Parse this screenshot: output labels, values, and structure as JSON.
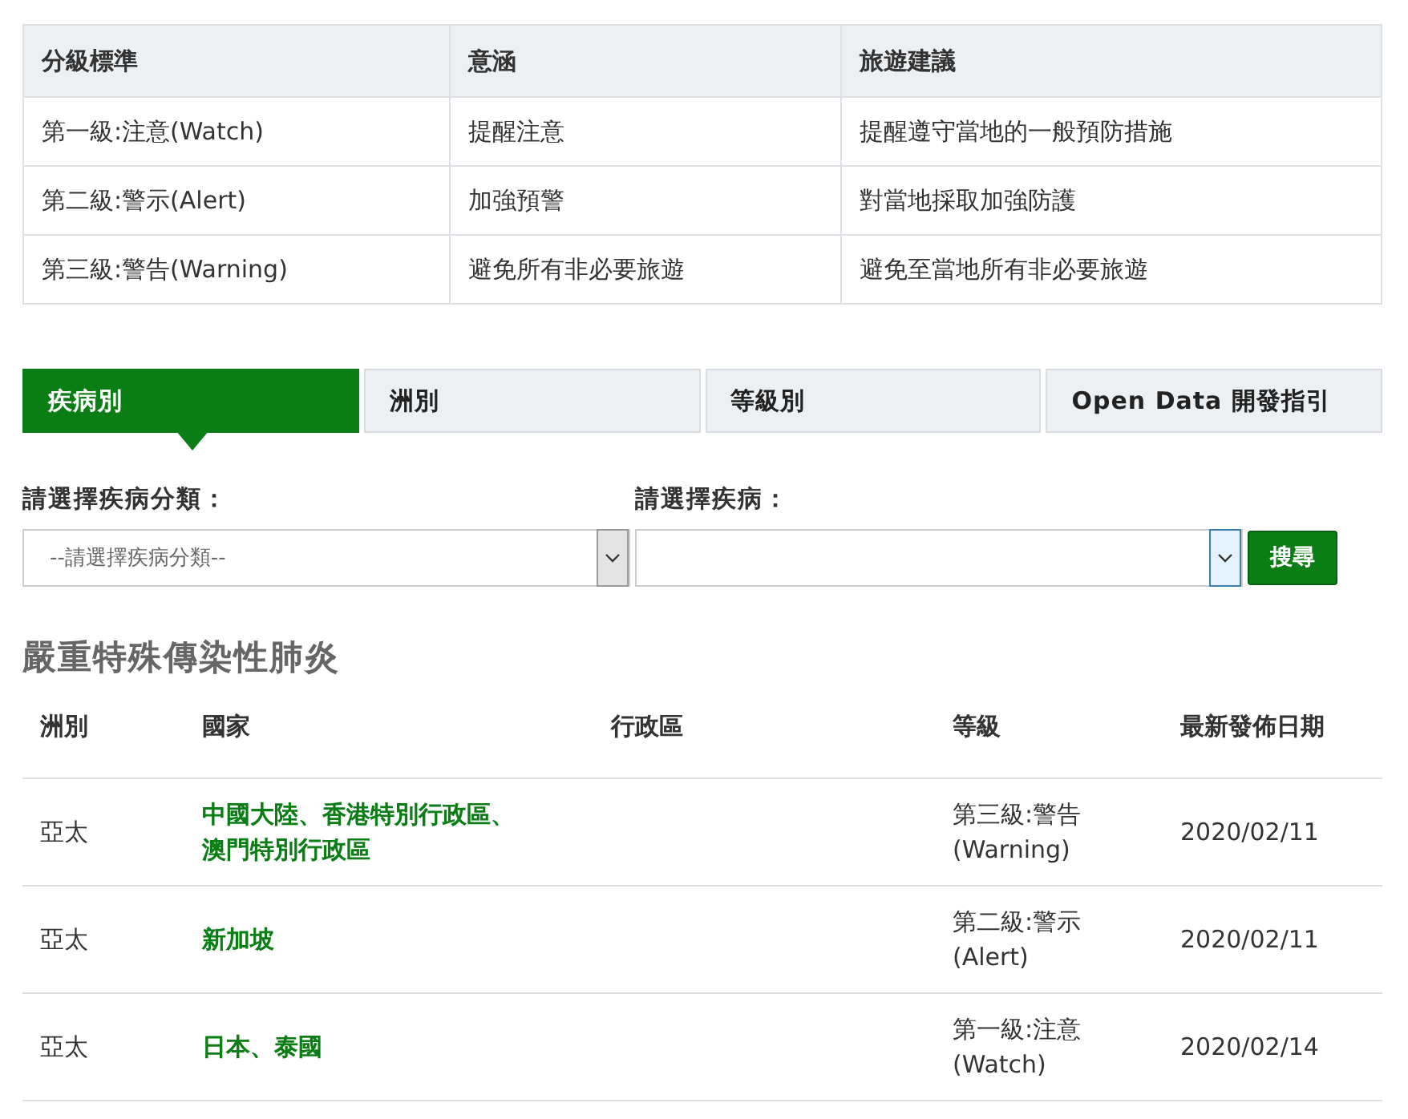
{
  "level_table": {
    "columns": [
      "分級標準",
      "意涵",
      "旅遊建議"
    ],
    "rows": [
      [
        "第一級:注意(Watch)",
        "提醒注意",
        "提醒遵守當地的一般預防措施"
      ],
      [
        "第二級:警示(Alert)",
        "加強預警",
        "對當地採取加強防護"
      ],
      [
        "第三級:警告(Warning)",
        "避免所有非必要旅遊",
        "避免至當地所有非必要旅遊"
      ]
    ]
  },
  "tabs": [
    {
      "label": "疾病別",
      "selected": true
    },
    {
      "label": "洲別",
      "selected": false
    },
    {
      "label": "等級別",
      "selected": false
    },
    {
      "label": "Open Data 開發指引",
      "selected": false
    }
  ],
  "filters": [
    {
      "label": "請選擇疾病分類：",
      "value": "--請選擇疾病分類--",
      "focused": false
    },
    {
      "label": "請選擇疾病：",
      "focused": true
    }
  ],
  "search_button": "搜尋",
  "disease_title": "嚴重特殊傳染性肺炎",
  "results": {
    "columns": [
      "洲別",
      "國家",
      "行政區",
      "等級",
      "最新發佈日期"
    ],
    "rows": [
      {
        "continent": "亞太",
        "country": "中國大陸、香港特別行政區、澳門特別行政區",
        "level": "第三級:警告(Warning)",
        "date": "2020/02/11"
      },
      {
        "continent": "亞太",
        "country": "新加坡",
        "level": "第二級:警示(Alert)",
        "date": "2020/02/11"
      },
      {
        "continent": "亞太",
        "country": "日本、泰國",
        "level": "第一級:注意(Watch)",
        "date": "2020/02/14"
      }
    ]
  }
}
